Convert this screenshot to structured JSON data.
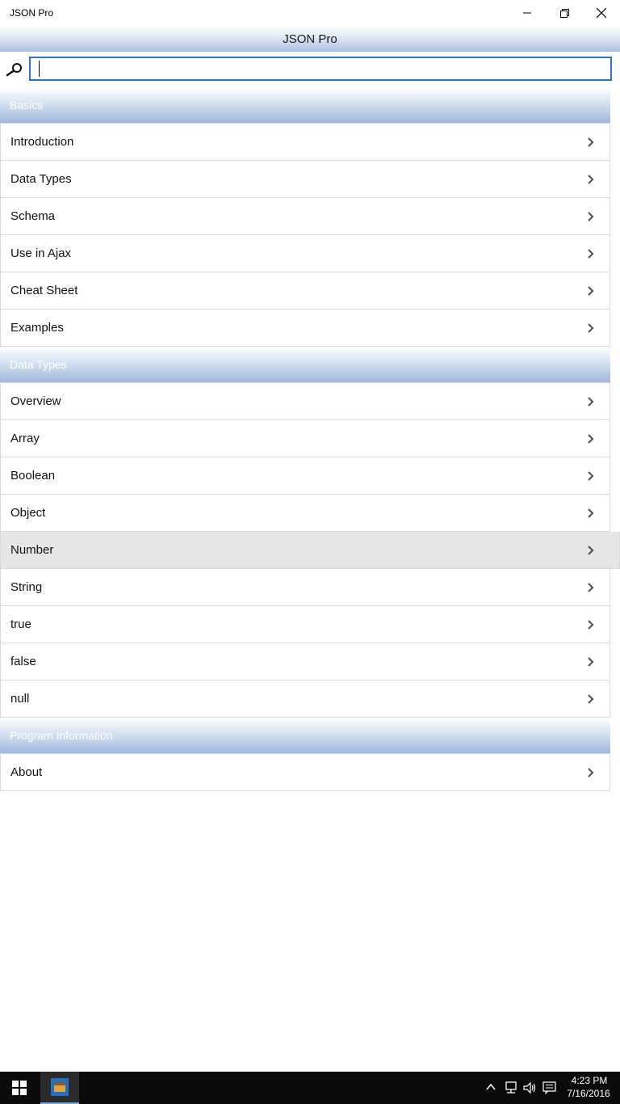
{
  "window": {
    "title": "JSON Pro"
  },
  "header": {
    "title": "JSON Pro"
  },
  "search": {
    "value": "",
    "placeholder": ""
  },
  "sections": [
    {
      "title": "Basics",
      "items": [
        "Introduction",
        "Data Types",
        "Schema",
        "Use in Ajax",
        "Cheat Sheet",
        "Examples"
      ]
    },
    {
      "title": "Data Types",
      "items": [
        "Overview",
        "Array",
        "Boolean",
        "Object",
        "Number",
        "String",
        "true",
        "false",
        "null"
      ]
    },
    {
      "title": "Program Information",
      "items": [
        "About"
      ]
    }
  ],
  "selected_item": "Number",
  "taskbar": {
    "time": "4:23 PM",
    "date": "7/16/2016"
  },
  "colors": {
    "accent": "#2b74c6",
    "header_gradient_end": "#a9c0e0",
    "selected_row": "#e6e6e6",
    "taskbar": "#0a0a0a"
  }
}
